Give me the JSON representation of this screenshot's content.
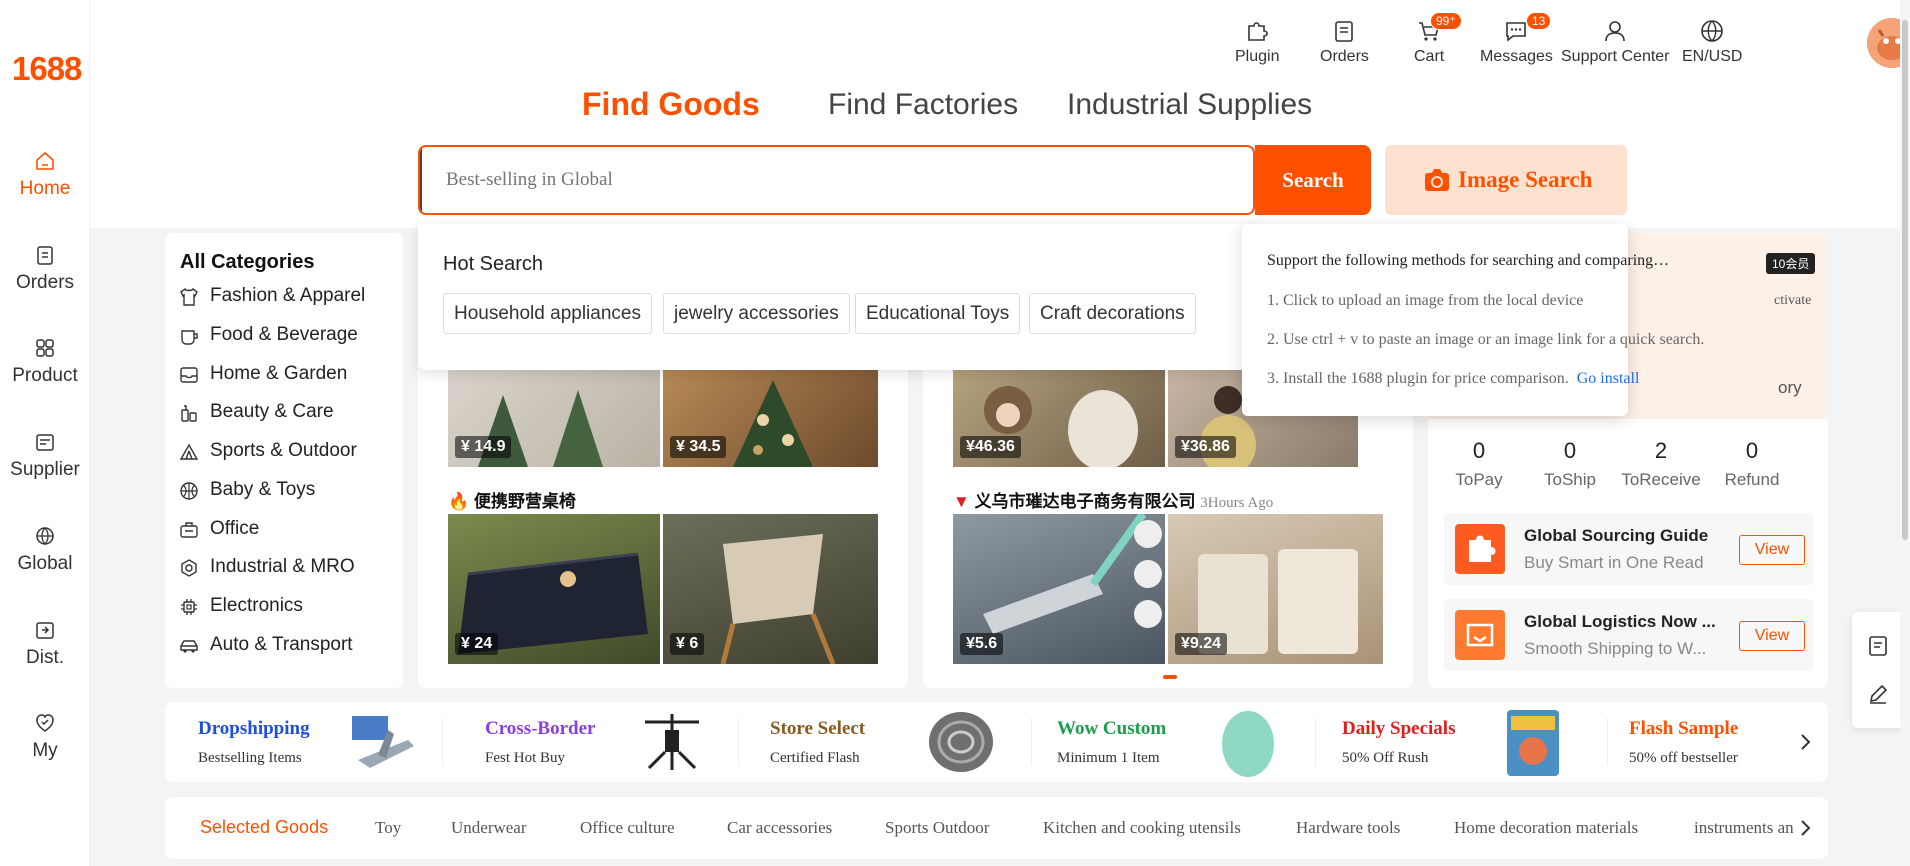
{
  "logo": "1688",
  "sidebar": {
    "items": [
      {
        "label": "Home",
        "icon": "home-icon"
      },
      {
        "label": "Orders",
        "icon": "clipboard-icon"
      },
      {
        "label": "Product",
        "icon": "grid-icon"
      },
      {
        "label": "Supplier",
        "icon": "store-icon"
      },
      {
        "label": "Global",
        "icon": "globe-icon"
      },
      {
        "label": "Dist.",
        "icon": "distribution-icon"
      },
      {
        "label": "My",
        "icon": "heart-shield-icon"
      }
    ]
  },
  "topbar": {
    "items": [
      {
        "label": "Plugin",
        "icon": "puzzle-icon"
      },
      {
        "label": "Orders",
        "icon": "orders-icon"
      },
      {
        "label": "Cart",
        "icon": "cart-icon",
        "badge": "99⁺"
      },
      {
        "label": "Messages",
        "icon": "message-icon",
        "badge": "13"
      },
      {
        "label": "Support Center",
        "icon": "person-icon"
      },
      {
        "label": "EN/USD",
        "icon": "globe-icon"
      }
    ]
  },
  "nav_tabs": [
    "Find Goods",
    "Find Factories",
    "Industrial Supplies"
  ],
  "search": {
    "placeholder": "Best-selling in Global",
    "button": "Search",
    "image_search": "Image Search"
  },
  "hot_search": {
    "title": "Hot Search",
    "tags": [
      "Household appliances",
      "jewelry accessories",
      "Educational Toys",
      "Craft decorations"
    ]
  },
  "image_search_tooltip": {
    "title": "Support the following methods for searching and comparing…",
    "lines": [
      "1. Click to upload an image from the local device",
      "2. Use ctrl + v to paste an image or an image link for a quick search.",
      "3. Install the 1688 plugin for price comparison."
    ],
    "link": "Go install"
  },
  "categories": {
    "title": "All Categories",
    "items": [
      {
        "label": "Fashion & Apparel",
        "icon": "shirt-icon"
      },
      {
        "label": "Food & Beverage",
        "icon": "cup-icon"
      },
      {
        "label": "Home & Garden",
        "icon": "inbox-icon"
      },
      {
        "label": "Beauty & Care",
        "icon": "bottle-icon"
      },
      {
        "label": "Sports & Outdoor",
        "icon": "tent-icon"
      },
      {
        "label": "Baby & Toys",
        "icon": "ball-icon"
      },
      {
        "label": "Office",
        "icon": "briefcase-icon"
      },
      {
        "label": "Industrial & MRO",
        "icon": "gear-icon"
      },
      {
        "label": "Electronics",
        "icon": "chip-icon"
      },
      {
        "label": "Auto & Transport",
        "icon": "car-icon"
      }
    ]
  },
  "feed_left": {
    "top_prices": [
      "¥ 14.9",
      "¥ 34.5"
    ],
    "section_title": "便携野营桌椅",
    "bottom_prices": [
      "¥ 24",
      "¥ 6"
    ]
  },
  "feed_mid": {
    "top_prices": [
      "¥46.36",
      "¥36.86"
    ],
    "section_title": "义乌市璀达电子商务有限公司",
    "section_time": "3Hours Ago",
    "bottom_prices": [
      "¥5.6",
      "¥9.24"
    ]
  },
  "user_panel": {
    "member_tag": "10会员",
    "activate": "ctivate",
    "memory": "ory",
    "stats": [
      {
        "value": "0",
        "label": "ToPay"
      },
      {
        "value": "0",
        "label": "ToShip"
      },
      {
        "value": "2",
        "label": "ToReceive"
      },
      {
        "value": "0",
        "label": "Refund"
      }
    ],
    "promos": [
      {
        "title": "Global Sourcing Guide",
        "subtitle": "Buy Smart in One Read",
        "button": "View"
      },
      {
        "title": "Global Logistics Now ...",
        "subtitle": "Smooth Shipping to W...",
        "button": "View"
      }
    ]
  },
  "services": [
    {
      "title": "Dropshipping",
      "subtitle": "Bestselling Items",
      "color": "#1d4fd8"
    },
    {
      "title": "Cross-Border",
      "subtitle": "Fest Hot Buy",
      "color": "#8a3ee6"
    },
    {
      "title": "Store Select",
      "subtitle": "Certified Flash",
      "color": "#8a5a1e"
    },
    {
      "title": "Wow Custom",
      "subtitle": "Minimum 1 Item",
      "color": "#1a9e4b"
    },
    {
      "title": "Daily Specials",
      "subtitle": "50% Off Rush",
      "color": "#e01e1e"
    },
    {
      "title": "Flash Sample",
      "subtitle": "50% off bestseller",
      "color": "#ff5000"
    }
  ],
  "goods_tabs": [
    "Selected Goods",
    "Toy",
    "Underwear",
    "Office culture",
    "Car accessories",
    "Sports Outdoor",
    "Kitchen and cooking utensils",
    "Hardware tools",
    "Home decoration materials",
    "instruments an"
  ],
  "colors": {
    "accent": "#ff5000",
    "link": "#1b6ef3"
  }
}
